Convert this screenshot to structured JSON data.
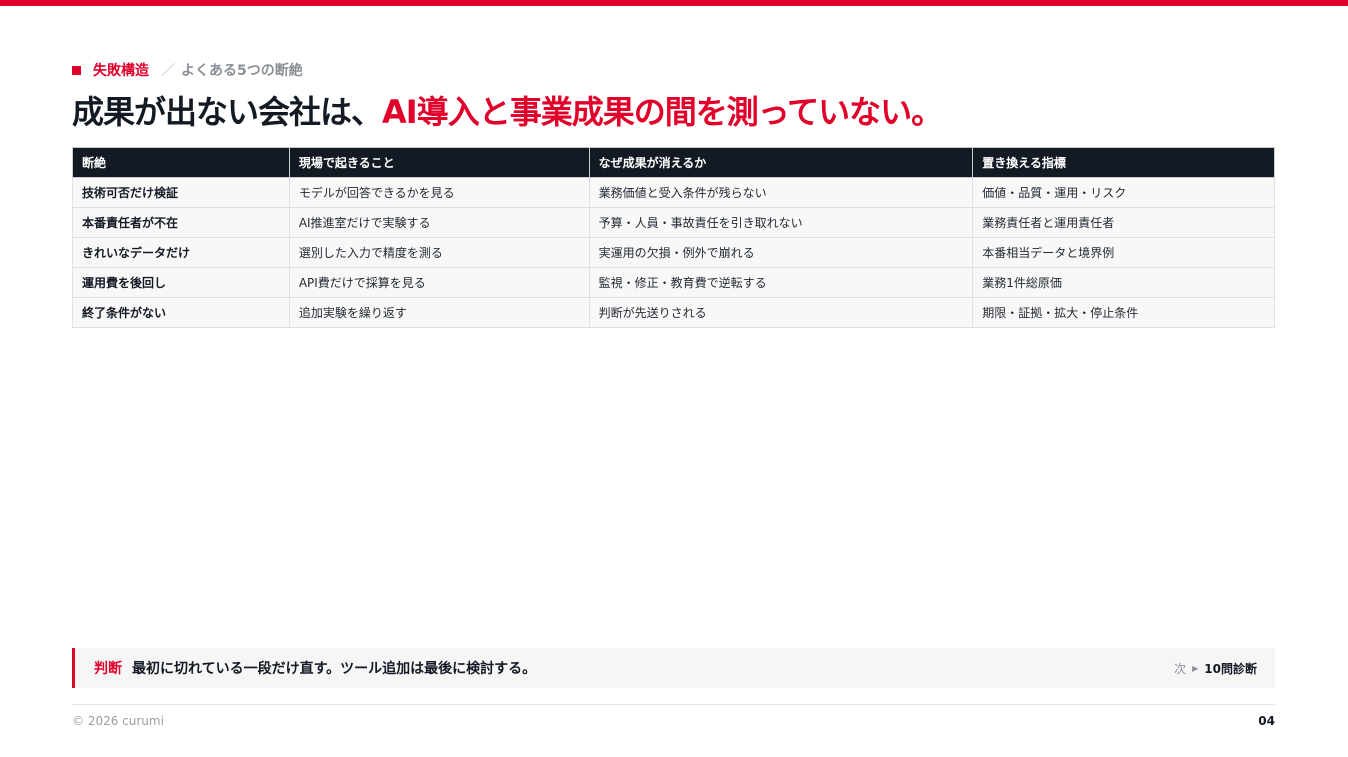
{
  "colors": {
    "accent": "#e0002a",
    "header_bg": "#141a24"
  },
  "kicker": {
    "label": "失敗構造",
    "separator": "／",
    "subtitle": "よくある5つの断絶"
  },
  "headline": {
    "plain": "成果が出ない会社は、",
    "accent": "AI導入と事業成果の間を測っていない。"
  },
  "table": {
    "headers": [
      "断絶",
      "現場で起きること",
      "なぜ成果が消えるか",
      "置き換える指標"
    ],
    "rows": [
      [
        "技術可否だけ検証",
        "モデルが回答できるかを見る",
        "業務価値と受入条件が残らない",
        "価値・品質・運用・リスク"
      ],
      [
        "本番責任者が不在",
        "AI推進室だけで実験する",
        "予算・人員・事故責任を引き取れない",
        "業務責任者と運用責任者"
      ],
      [
        "きれいなデータだけ",
        "選別した入力で精度を測る",
        "実運用の欠損・例外で崩れる",
        "本番相当データと境界例"
      ],
      [
        "運用費を後回し",
        "API費だけで採算を見る",
        "監視・修正・教育費で逆転する",
        "業務1件総原価"
      ],
      [
        "終了条件がない",
        "追加実験を繰り返す",
        "判断が先送りされる",
        "期限・証拠・拡大・停止条件"
      ]
    ]
  },
  "verdict": {
    "label": "判断",
    "text": "最初に切れている一段だけ直す。ツール追加は最後に検討する。",
    "next_label": "次",
    "next_icon": "play-arrow-icon",
    "next_target": "10問診断"
  },
  "footer": {
    "copyright": "© 2026 curumi",
    "page": "04"
  }
}
